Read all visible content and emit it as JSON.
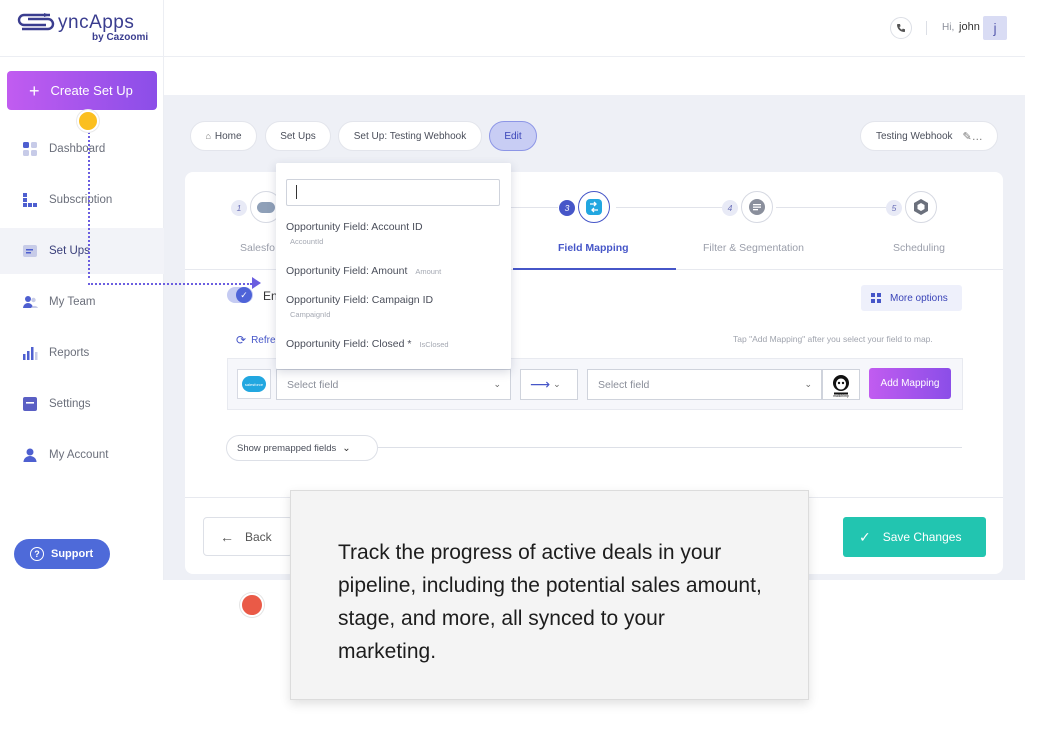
{
  "brand": {
    "name": "yncApps",
    "sub": "by Cazoomi",
    "colors": {
      "primary": "#3a3d8f",
      "accent_gradient": [
        "#c15cf0",
        "#8b4ee8"
      ],
      "save": "#22c5b0",
      "tour_dot_yellow": "#fbbf1f",
      "tour_dot_red": "#ea5a47"
    }
  },
  "topbar": {
    "greeting_prefix": "Hi,",
    "user_name": "john",
    "avatar_initial": "j",
    "phone_icon": "phone-icon"
  },
  "sidebar": {
    "create_label": "Create Set Up",
    "items": [
      {
        "label": "Dashboard",
        "icon": "dashboard-icon"
      },
      {
        "label": "Subscription",
        "icon": "subscription-icon"
      },
      {
        "label": "Set Ups",
        "icon": "setups-icon",
        "active": true
      },
      {
        "label": "My Team",
        "icon": "team-icon"
      },
      {
        "label": "Reports",
        "icon": "reports-icon"
      },
      {
        "label": "Settings",
        "icon": "settings-icon"
      },
      {
        "label": "My Account",
        "icon": "account-icon"
      }
    ],
    "support_label": "Support"
  },
  "breadcrumbs": {
    "home": "Home",
    "setups": "Set Ups",
    "current": "Set Up: Testing Webhook",
    "edit": "Edit",
    "setup_name": "Testing Webhook"
  },
  "steps": [
    {
      "num": "1",
      "label": "Salesfo"
    },
    {
      "num": "3",
      "label": "Field Mapping",
      "active": true
    },
    {
      "num": "4",
      "label": "Filter & Segmentation"
    },
    {
      "num": "5",
      "label": "Scheduling"
    }
  ],
  "mapping": {
    "toggle_label": "En",
    "more_options": "More options",
    "refresh_label": "Refre",
    "hint": "Tap \"Add Mapping\" after you select your field to map.",
    "source_placeholder": "Select field",
    "target_placeholder": "Select field",
    "add_mapping": "Add Mapping",
    "show_premapped": "Show premapped fields",
    "source_logo_text": "salesforce",
    "target_logo_text": "mailchimp"
  },
  "dropdown": {
    "items": [
      {
        "label": "Opportunity Field: Account ID",
        "sub": "AccountId"
      },
      {
        "label": "Opportunity Field: Amount",
        "sub": "Amount"
      },
      {
        "label": "Opportunity Field: Campaign ID",
        "sub": "CampaignId"
      },
      {
        "label": "Opportunity Field: Closed *",
        "sub": "IsClosed"
      }
    ]
  },
  "footer": {
    "back": "Back",
    "save": "Save Changes"
  },
  "tour": {
    "text": "Track the progress of active deals in your pipeline, including the potential sales amount, stage, and more, all synced to your marketing."
  }
}
